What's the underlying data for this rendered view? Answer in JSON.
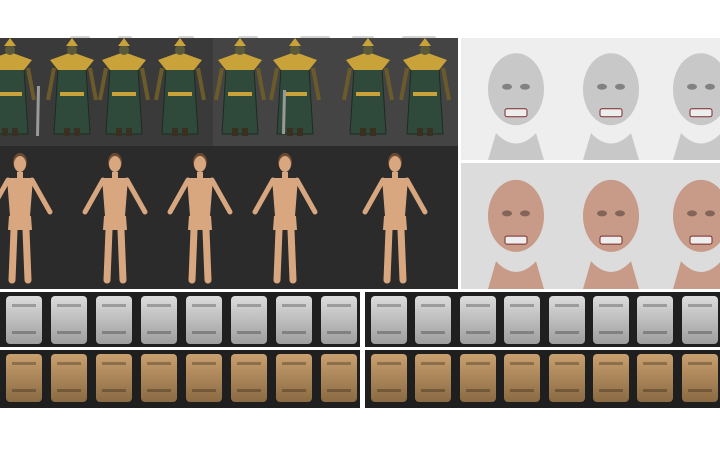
{
  "colors": {
    "background": "#ffffff",
    "panel_dark": "#2b2b2b",
    "panel_mid": "#3a3a3a",
    "skin": "#d8a77f",
    "gold": "#c9a23a",
    "robe": "#2f4a3a",
    "gear_grey": "#bdbdbd",
    "gear_tan": "#b08a5a",
    "zombie_skin": "#c89a88"
  },
  "panels": {
    "warlord_views": 8,
    "human_views": 5,
    "zombie_grey_views": 3,
    "zombie_color_views": 3,
    "bag_grey_views": 8,
    "bag_tan_views": 8,
    "vest_grey_views": 8,
    "vest_tan_views": 8
  }
}
